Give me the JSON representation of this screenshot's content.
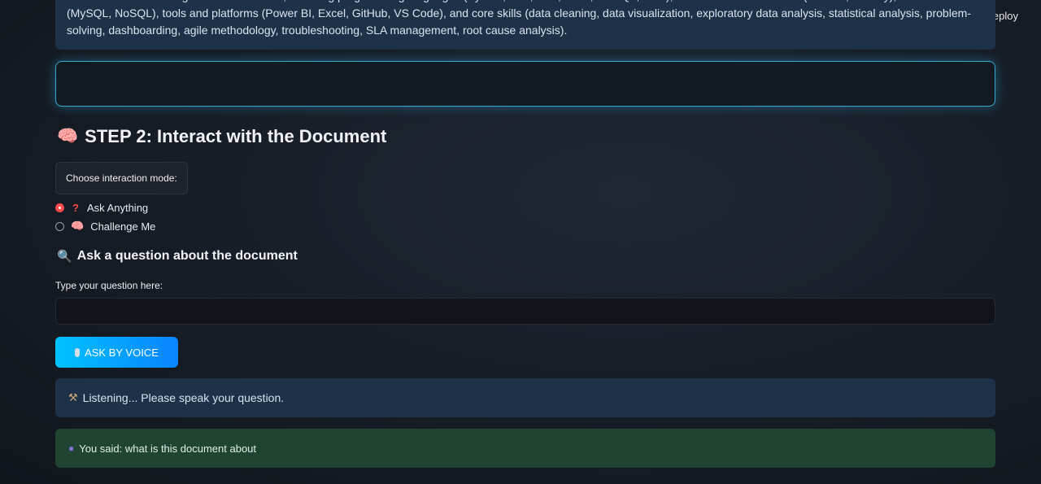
{
  "header": {
    "deploy_label": "Deploy"
  },
  "summary": {
    "text": "Skills: Anime has a range of technical skills, including programming languages (Python, R23, C++, Bash, PL/SQL, PHP), libraries and frameworks (Pandas, NumPy), databases (MySQL, NoSQL), tools and platforms (Power BI, Excel, GitHub, VS Code), and core skills (data cleaning, data visualization, exploratory data analysis, statistical analysis, problem-solving, dashboarding, agile methodology, troubleshooting, SLA management, root cause analysis)."
  },
  "step2": {
    "title": "STEP 2: Interact with the Document",
    "icon": "brain-icon"
  },
  "mode": {
    "label": "Choose interaction mode:",
    "options": [
      {
        "label": "Ask Anything",
        "icon": "question-icon",
        "selected": true
      },
      {
        "label": "Challenge Me",
        "icon": "brain-icon",
        "selected": false
      }
    ]
  },
  "ask": {
    "heading": "Ask a question about the document",
    "icon": "magnifier-icon",
    "input_label": "Type your question here:",
    "input_value": ""
  },
  "voice_button": {
    "label": "ASK BY VOICE",
    "icon": "microphone-icon"
  },
  "status": {
    "listening": "Listening... Please speak your question.",
    "listening_icon": "hammer-icon",
    "you_said": "You said: what is this document about",
    "you_said_icon": "speech-bubble-icon"
  },
  "colors": {
    "accent": "#ff4b4b",
    "info_bg": "#1d3148",
    "success_bg": "#1f4532",
    "button_gradient_start": "#00c2ff",
    "button_gradient_end": "#0a84ff",
    "input_glow": "#3aa6c9"
  }
}
